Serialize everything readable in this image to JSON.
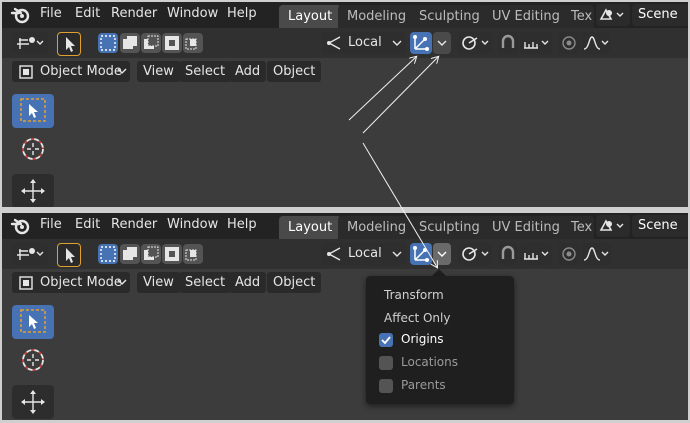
{
  "top": {
    "menu": [
      "File",
      "Edit",
      "Render",
      "Window",
      "Help"
    ],
    "workspace_tabs": [
      "Layout",
      "Modeling",
      "Sculpting",
      "UV Editing",
      "Tex"
    ],
    "active_tab": "Layout",
    "scene_name": "Scene"
  },
  "toolbar": {
    "transform_orientation": "Local"
  },
  "header": {
    "mode": "Object Mode",
    "menus": [
      "View",
      "Select",
      "Add",
      "Object"
    ]
  },
  "popup": {
    "title1": "Transform",
    "title2": "Affect Only",
    "options": [
      {
        "label": "Origins",
        "checked": true
      },
      {
        "label": "Locations",
        "checked": false
      },
      {
        "label": "Parents",
        "checked": false
      }
    ]
  },
  "colors": {
    "accent": "#4772b3",
    "background": "#3c3c3c",
    "topbar": "#232323",
    "popup": "#1f1f1f"
  }
}
